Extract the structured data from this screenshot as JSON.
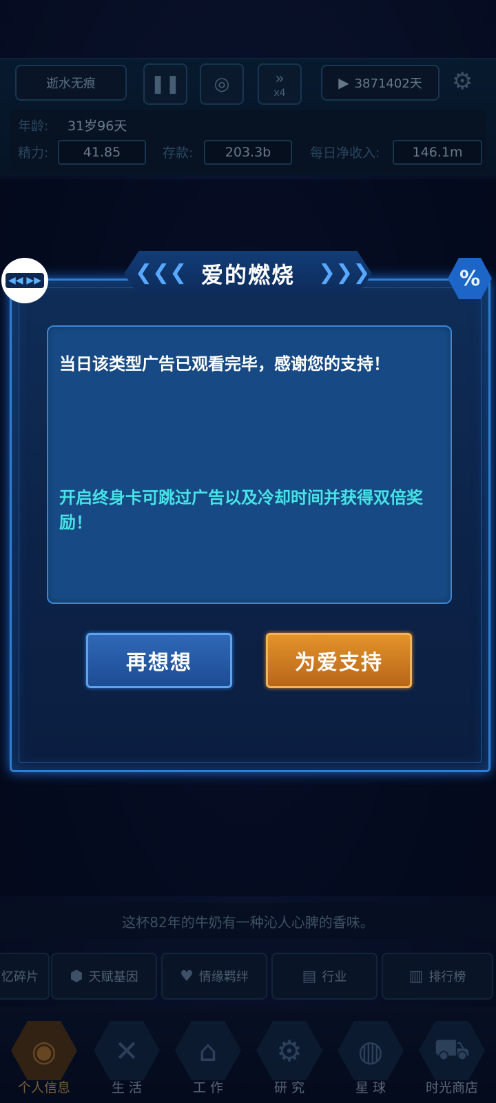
{
  "header": {
    "player_name": "逝水无痕",
    "speed_label": "x4",
    "video_days": "3871402天",
    "age_label": "年龄:",
    "age_value": "31岁96天",
    "energy_label": "精力:",
    "energy_value": "41.85",
    "savings_label": "存款:",
    "savings_value": "203.3b",
    "daily_income_label": "每日净收入:",
    "daily_income_value": "146.1m"
  },
  "modal": {
    "title": "爱的燃烧",
    "message_primary": "当日该类型广告已观看完毕，感谢您的支持！",
    "message_secondary": "开启终身卡可跳过广告以及冷却时间并获得双倍奖励！",
    "cancel_label": "再想想",
    "confirm_label": "为爱支持"
  },
  "ticker": {
    "text": "这杯82年的牛奶有一种沁人心脾的香味。"
  },
  "sub_tabs": [
    {
      "label": "忆碎片",
      "icon": "memory-fragment-icon"
    },
    {
      "label": "天赋基因",
      "icon": "gene-icon"
    },
    {
      "label": "情缘羁绊",
      "icon": "romance-icon"
    },
    {
      "label": "行业",
      "icon": "industry-icon"
    },
    {
      "label": "排行榜",
      "icon": "ranking-icon"
    }
  ],
  "bottom_nav": [
    {
      "label": "个人信息",
      "icon": "fingerprint-icon",
      "active": true
    },
    {
      "label": "生 活",
      "icon": "utensils-icon",
      "active": false
    },
    {
      "label": "工 作",
      "icon": "desk-worker-icon",
      "active": false
    },
    {
      "label": "研 究",
      "icon": "dna-gear-icon",
      "active": false
    },
    {
      "label": "星 球",
      "icon": "globe-icon",
      "active": false
    },
    {
      "label": "时光商店",
      "icon": "shop-cart-icon",
      "active": false
    }
  ],
  "colors": {
    "modal_border": "#2e7fd1",
    "highlight_text": "#47e3e6",
    "confirm_button": "#e3932a",
    "cancel_button": "#2f68b6"
  }
}
